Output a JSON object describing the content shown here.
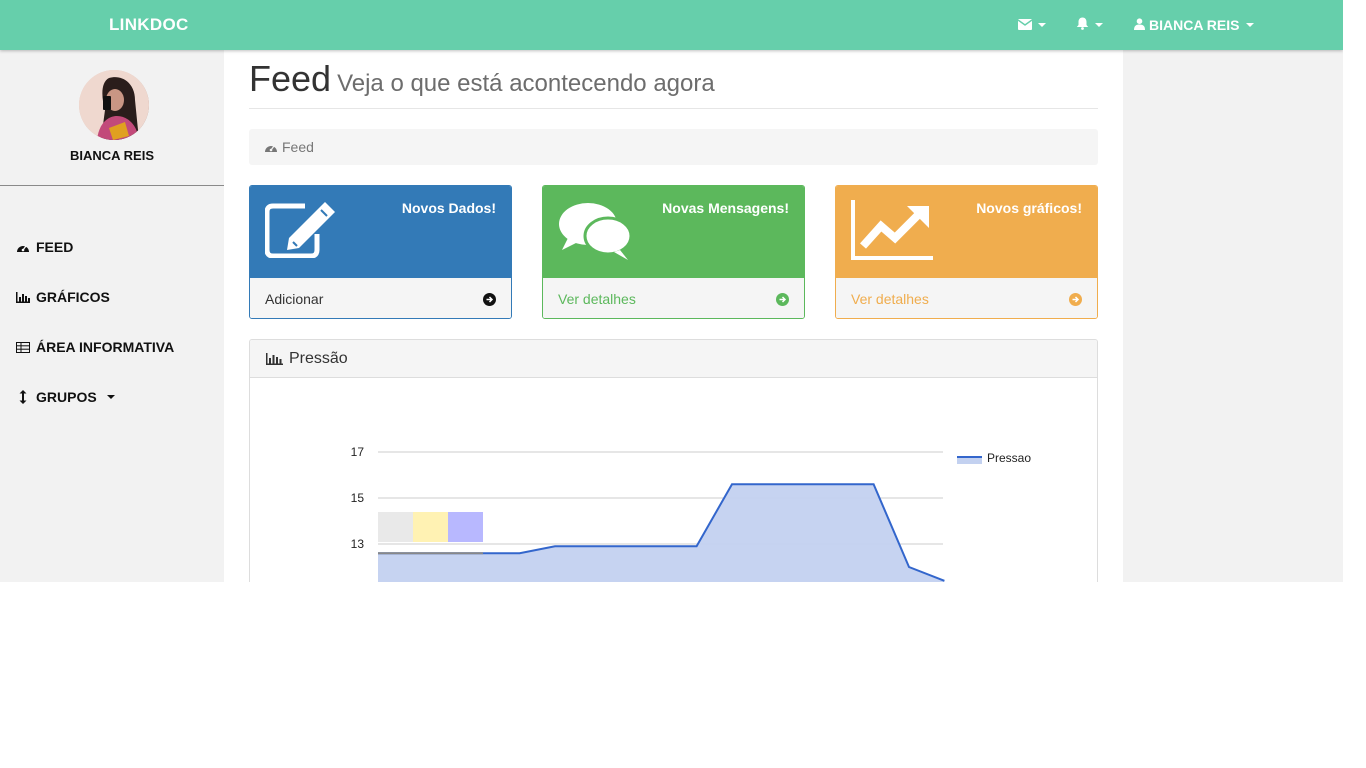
{
  "navbar": {
    "brand": "LINKDOC",
    "user_name": "BIANCA REIS",
    "icons": [
      "envelope-icon",
      "bell-icon",
      "user-icon"
    ]
  },
  "sidebar": {
    "profile_name": "BIANCA REIS",
    "items": [
      {
        "label": "FEED",
        "icon": "dashboard-icon"
      },
      {
        "label": "GRÁFICOS",
        "icon": "bar-chart-icon"
      },
      {
        "label": "ÁREA INFORMATIVA",
        "icon": "table-icon"
      },
      {
        "label": "GRUPOS",
        "icon": "vertical-arrows-icon"
      }
    ]
  },
  "header": {
    "title": "Feed",
    "subtitle": "Veja o que está acontecendo agora"
  },
  "breadcrumb": {
    "label": "Feed",
    "icon": "dashboard-icon"
  },
  "cards": [
    {
      "title": "Novos Dados!",
      "footer": "Adicionar",
      "icon": "edit-icon",
      "color": "#337ab7",
      "footer_color": "#333333"
    },
    {
      "title": "Novas Mensagens!",
      "footer": "Ver detalhes",
      "icon": "comments-icon",
      "color": "#5cb85c",
      "footer_color": "#5cb85c"
    },
    {
      "title": "Novos gráficos!",
      "footer": "Ver detalhes",
      "icon": "line-chart-icon",
      "color": "#f0ad4e",
      "footer_color": "#f0ad4e"
    }
  ],
  "chart_panel": {
    "title": "Pressão",
    "icon": "bar-chart-icon"
  },
  "colors": {
    "navbar": "#66cfab",
    "series": "#3366cc",
    "area_fill": "#c3d1f0"
  },
  "chart_data": {
    "type": "area",
    "series": [
      {
        "name": "Pressao",
        "x": [
          0,
          1,
          2,
          3,
          4,
          5,
          6,
          7,
          8,
          9,
          10,
          11,
          12,
          13,
          14,
          15,
          16
        ],
        "values": [
          12.6,
          12.6,
          12.6,
          12.6,
          12.6,
          12.9,
          12.9,
          12.9,
          12.9,
          12.9,
          15.6,
          15.6,
          15.6,
          15.6,
          15.6,
          12.0,
          11.4
        ]
      }
    ],
    "yticks": [
      13,
      15,
      17
    ],
    "ylim": [
      11.4,
      17
    ],
    "grid": true,
    "legend": "right"
  }
}
